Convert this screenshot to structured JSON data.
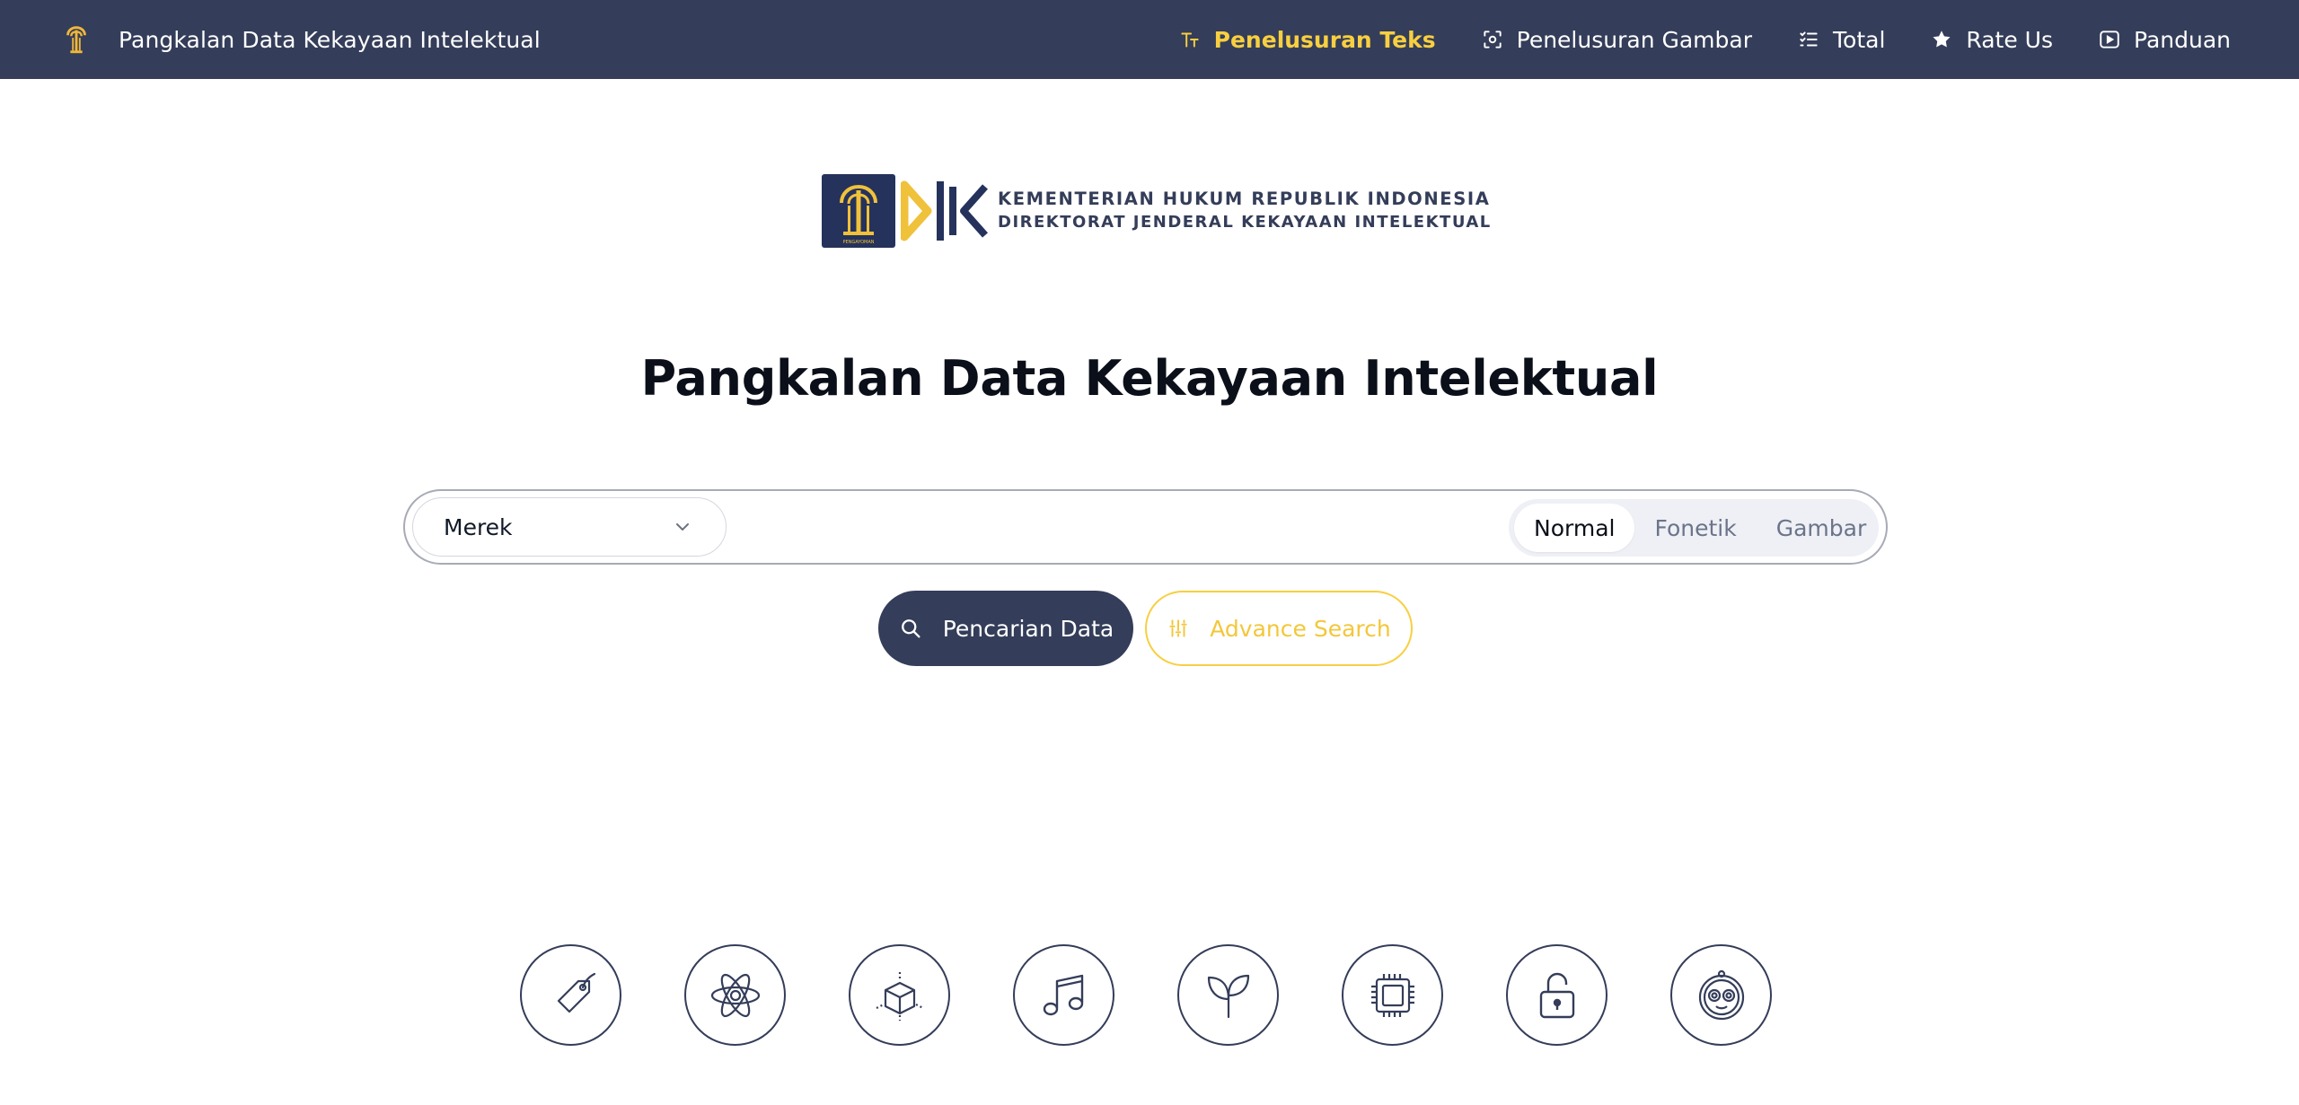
{
  "header": {
    "brand_title": "Pangkalan Data Kekayaan Intelektual",
    "nav": [
      {
        "label": "Penelusuran Teks",
        "icon": "text-size-icon",
        "active": true
      },
      {
        "label": "Penelusuran Gambar",
        "icon": "image-scan-icon",
        "active": false
      },
      {
        "label": "Total",
        "icon": "checklist-icon",
        "active": false
      },
      {
        "label": "Rate Us",
        "icon": "star-icon",
        "active": false
      },
      {
        "label": "Panduan",
        "icon": "play-video-icon",
        "active": false
      }
    ]
  },
  "logo": {
    "line1": "KEMENTERIAN HUKUM REPUBLIK INDONESIA",
    "line2": "DIREKTORAT JENDERAL KEKAYAAN INTELEKTUAL",
    "emblem_caption": "PENGAYOMAN"
  },
  "main": {
    "title": "Pangkalan Data Kekayaan Intelektual",
    "search": {
      "category_value": "Merek",
      "input_value": "",
      "modes": [
        {
          "label": "Normal",
          "active": true
        },
        {
          "label": "Fonetik",
          "active": false
        },
        {
          "label": "Gambar",
          "active": false
        }
      ]
    },
    "buttons": {
      "search_label": "Pencarian Data",
      "advance_label": "Advance Search"
    },
    "categories": [
      {
        "icon": "tag-icon"
      },
      {
        "icon": "atom-icon"
      },
      {
        "icon": "cube-design-icon"
      },
      {
        "icon": "music-note-icon"
      },
      {
        "icon": "plant-sprout-icon"
      },
      {
        "icon": "chip-icon"
      },
      {
        "icon": "padlock-icon"
      },
      {
        "icon": "mask-icon"
      }
    ]
  },
  "colors": {
    "navbar": "#343d59",
    "accent_yellow": "#f8cf40",
    "primary_button": "#343d59"
  }
}
